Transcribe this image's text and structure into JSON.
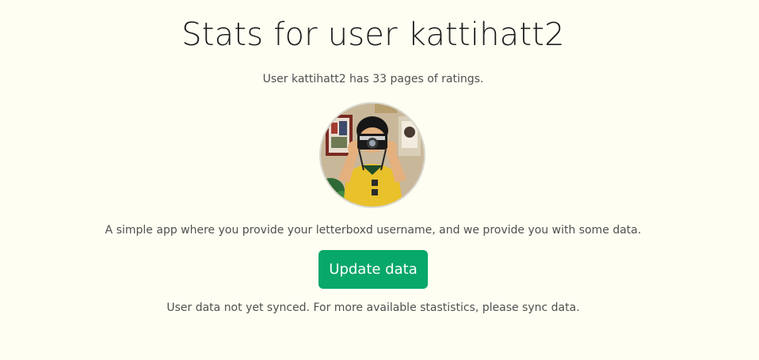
{
  "header": {
    "title": "Stats for user kattihatt2",
    "subtitle": "User kattihatt2 has 33 pages of ratings."
  },
  "profile": {
    "avatar_icon": "user-avatar-photo"
  },
  "main": {
    "description": "A simple app where you provide your letterboxd username, and we provide you with some data.",
    "update_button_label": "Update data",
    "sync_note": "User data not yet synced. For more available stastistics, please sync data."
  },
  "colors": {
    "background": "#fefef2",
    "accent": "#08a76a",
    "text": "#505050",
    "title": "#1e1e1e"
  }
}
